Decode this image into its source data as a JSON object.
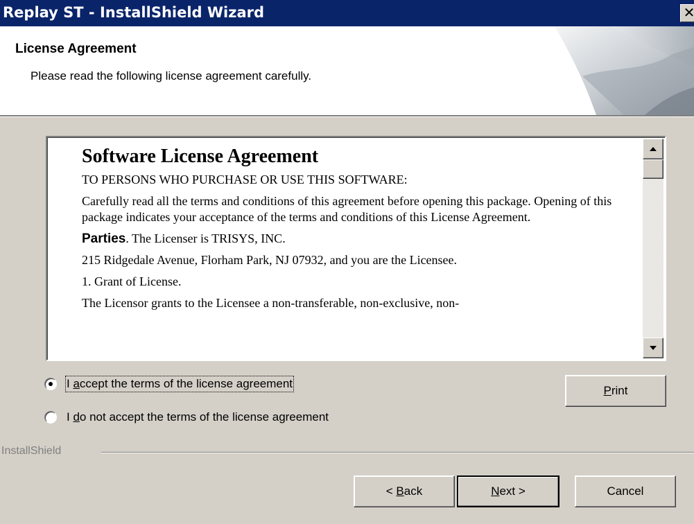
{
  "window": {
    "title": "Replay ST - InstallShield Wizard",
    "close_glyph": "✕"
  },
  "header": {
    "title": "License Agreement",
    "subtitle": "Please read the following license agreement carefully."
  },
  "license": {
    "heading": "Software License Agreement",
    "paragraphs": [
      "TO PERSONS WHO PURCHASE OR USE THIS SOFTWARE:",
      "Carefully read all the terms and conditions of this agreement before opening this package. Opening of this package indicates your acceptance of the terms and conditions of this License Agreement.",
      "215 Ridgedale Avenue, Florham Park, NJ 07932, and you are the Licensee.",
      "1. Grant of License.",
      "The Licensor grants to the Licensee a non-transferable, non-exclusive, non-"
    ],
    "parties_bold": "Parties",
    "parties_text": ". The Licenser is TRISYS, INC."
  },
  "options": {
    "accept": {
      "pre": "I ",
      "key": "a",
      "post": "ccept the terms of the license agreement",
      "checked": true
    },
    "decline": {
      "pre": "I ",
      "key": "d",
      "post": "o not accept the terms of the license agreement",
      "checked": false
    }
  },
  "buttons": {
    "print": {
      "key": "P",
      "rest": "rint"
    },
    "back": {
      "pre": "< ",
      "key": "B",
      "rest": "ack"
    },
    "next": {
      "key": "N",
      "rest": "ext >"
    },
    "cancel": "Cancel"
  },
  "footer": {
    "brand": "InstallShield"
  },
  "icons": {
    "scroll_up": "scroll-up-arrow-icon",
    "scroll_down": "scroll-down-arrow-icon",
    "close": "close-icon"
  }
}
